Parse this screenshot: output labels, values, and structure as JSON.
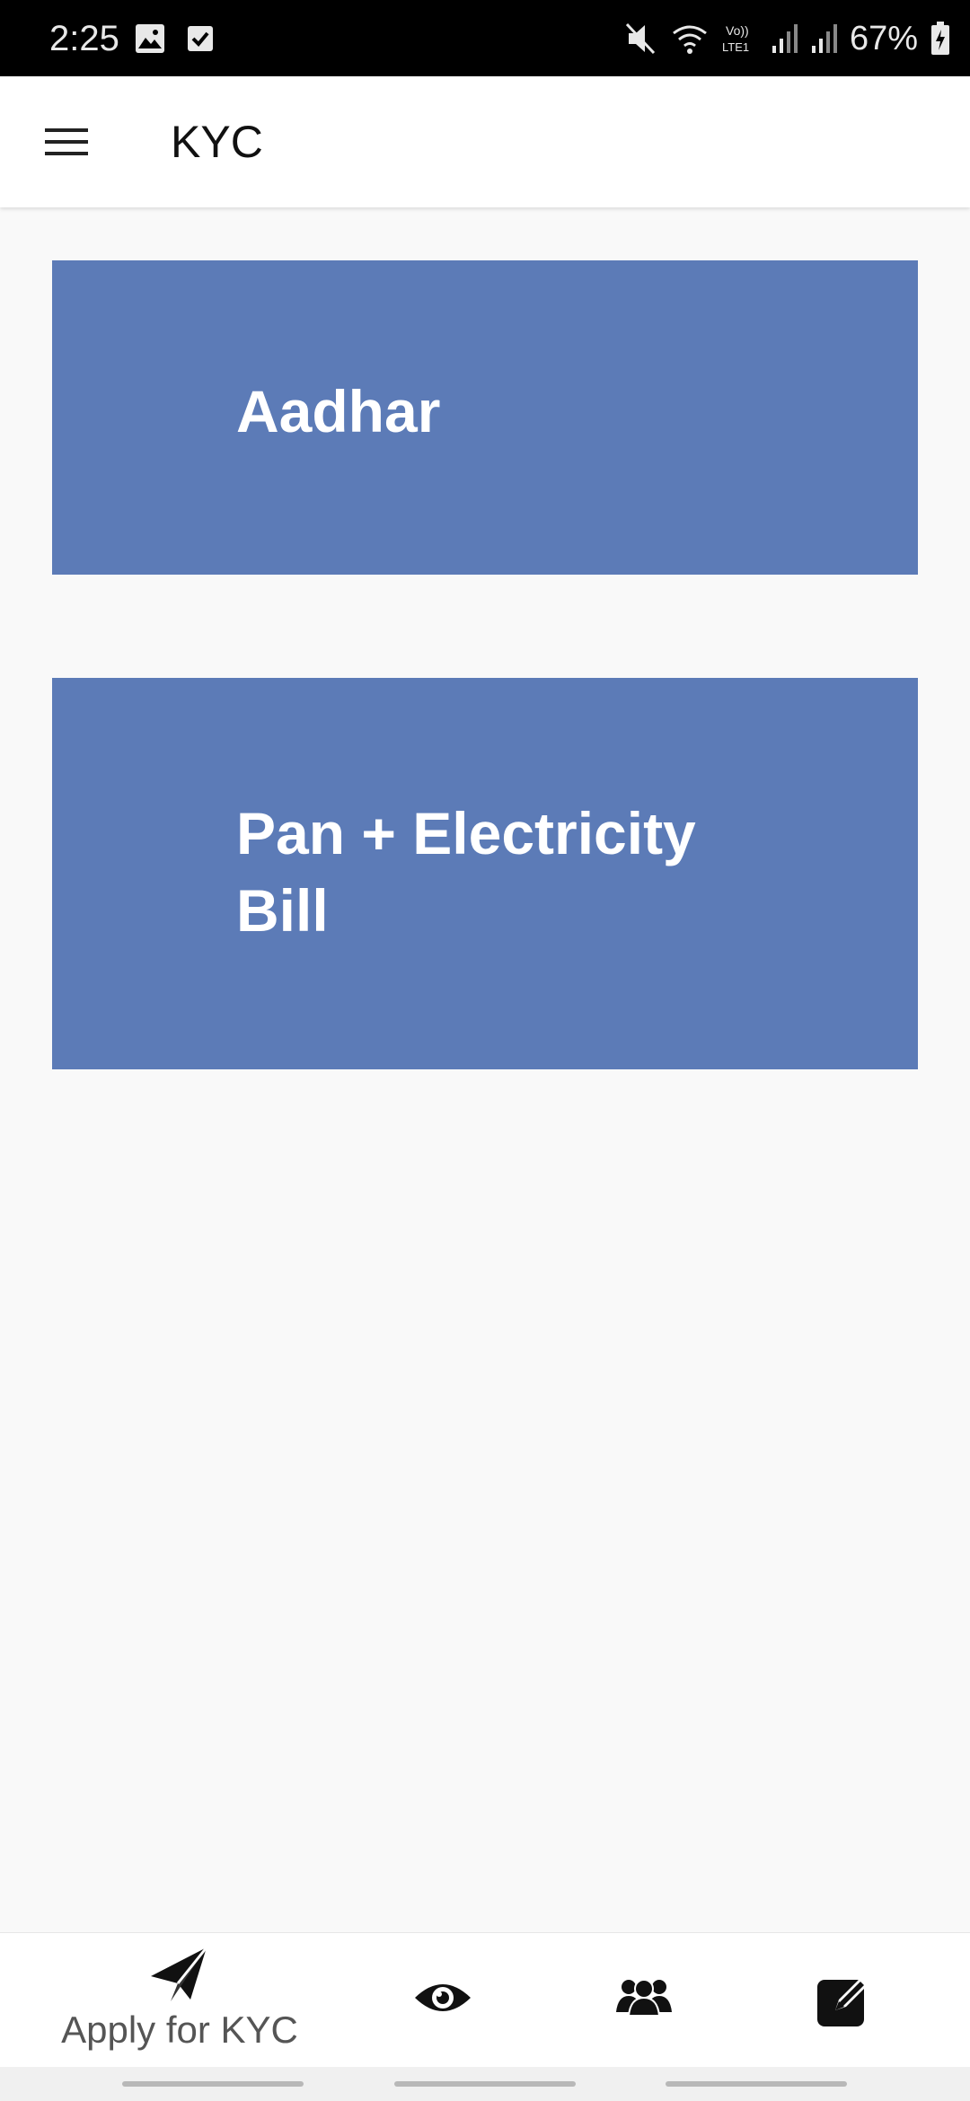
{
  "status_bar": {
    "time": "2:25",
    "battery": "67%",
    "icons": [
      "image-icon",
      "checkbox-icon",
      "mute-icon",
      "wifi-icon",
      "volte-icon",
      "signal-icon",
      "signal-icon",
      "battery-charging-icon"
    ]
  },
  "app_bar": {
    "title": "KYC",
    "menu_icon": "hamburger-menu-icon"
  },
  "cards": [
    {
      "label": "Aadhar"
    },
    {
      "label": "Pan + Electricity Bill"
    }
  ],
  "bottom_nav": {
    "apply": {
      "label": "Apply for KYC",
      "icon": "paper-plane-icon"
    },
    "view": {
      "icon": "eye-icon"
    },
    "team": {
      "icon": "users-icon"
    },
    "edit": {
      "icon": "edit-icon"
    }
  },
  "colors": {
    "card_bg": "#5c7bb7",
    "page_bg": "#f9f9f9",
    "status_bar_bg": "#000000"
  }
}
